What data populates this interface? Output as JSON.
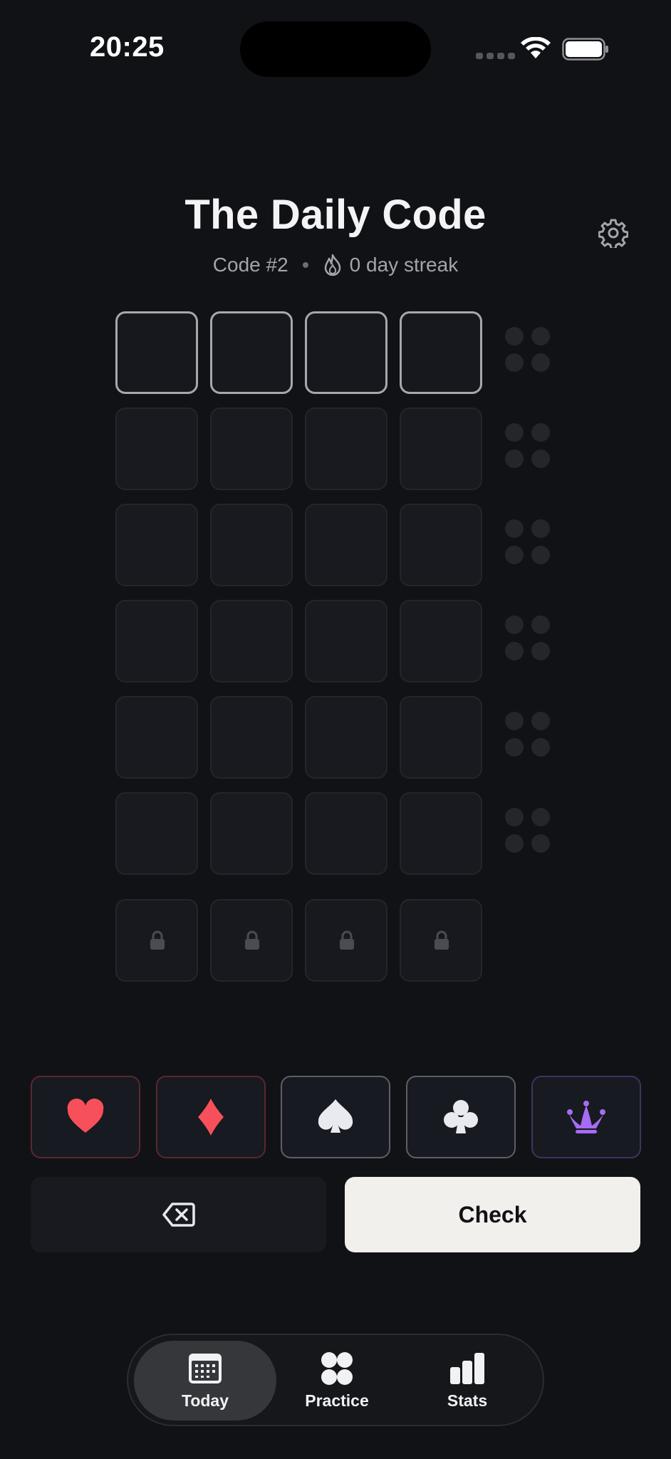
{
  "status_bar": {
    "time": "20:25",
    "icons": [
      "cellular-signal-icon",
      "wifi-icon",
      "battery-icon"
    ]
  },
  "header": {
    "title": "The Daily Code",
    "code_label": "Code #2",
    "streak_label": "0 day streak",
    "icons": [
      "gear-icon",
      "flame-icon"
    ]
  },
  "board": {
    "guess_rows": 6,
    "columns": 4,
    "active_row": 1,
    "secret_row": "locked",
    "icons": [
      "lock-icon"
    ]
  },
  "keypad": {
    "symbols": [
      {
        "name": "heart",
        "color": "#f7505a"
      },
      {
        "name": "diamond",
        "color": "#f7505a"
      },
      {
        "name": "spade",
        "color": "#e9eaf0"
      },
      {
        "name": "club",
        "color": "#e9eaf0"
      },
      {
        "name": "jester",
        "color": "#a66cf4"
      }
    ],
    "check_label": "Check",
    "icons": [
      "backspace-icon"
    ]
  },
  "tabs": [
    {
      "label": "Today",
      "icon": "calendar-icon",
      "selected": true
    },
    {
      "label": "Practice",
      "icon": "four-dots-icon",
      "selected": false
    },
    {
      "label": "Stats",
      "icon": "bar-chart-icon",
      "selected": false
    }
  ],
  "colors": {
    "background": "#111216",
    "accent_red": "#f7505a",
    "accent_purple": "#a66cf4",
    "check_button": "#f1f0ec"
  }
}
